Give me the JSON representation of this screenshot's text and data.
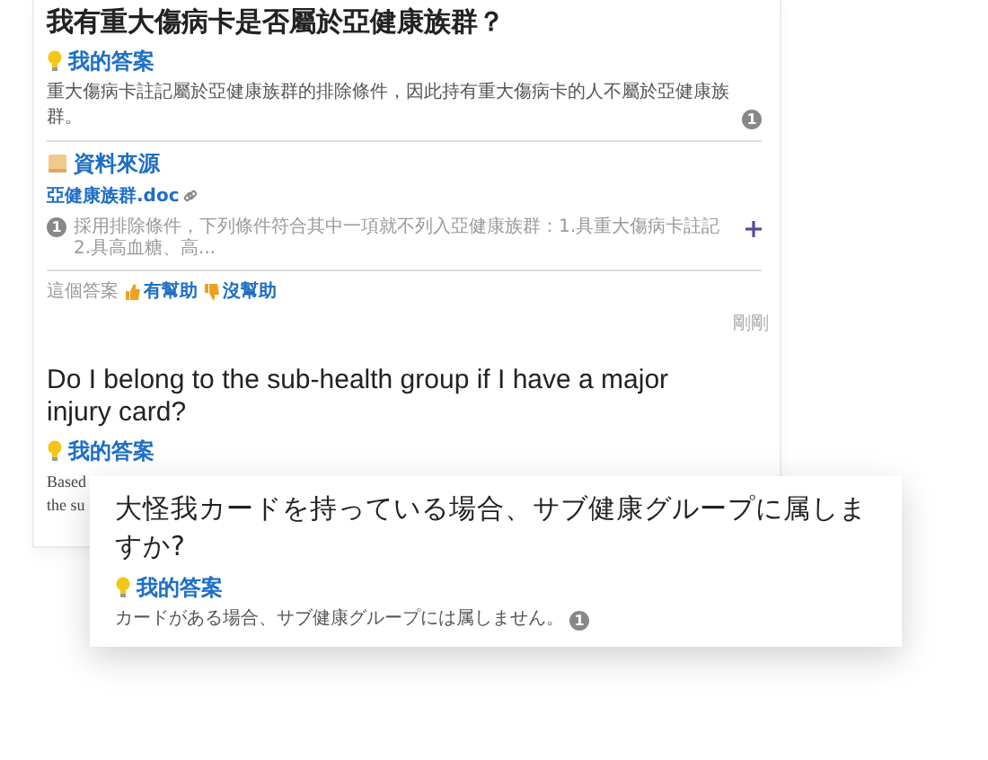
{
  "cards": [
    {
      "question": "我有重大傷病卡是否屬於亞健康族群？",
      "answer": {
        "heading": "我的答案",
        "text": "重大傷病卡註記屬於亞健康族群的排除條件，因此持有重大傷病卡的人不屬於亞健康族群。",
        "ref": "1"
      },
      "sources": {
        "heading": "資料來源",
        "items": [
          {
            "file": "亞健康族群.doc",
            "ref": "1",
            "excerpt": "採用排除條件，下列條件符合其中一項就不列入亞健康族群：1.具重大傷病卡註記 2.具高血糖、高..."
          }
        ]
      },
      "feedback": {
        "label": "這個答案",
        "helpful": "有幫助",
        "unhelpful": "沒幫助"
      },
      "time": "剛剛"
    },
    {
      "question": "Do I belong to the sub-health group if I have a major injury card?",
      "answer": {
        "heading": "我的答案",
        "lines": [
          "Based",
          "the su"
        ]
      }
    }
  ],
  "overlay": {
    "question": "大怪我カードを持っている場合、サブ健康グループに属しますか?",
    "answer": {
      "heading": "我的答案",
      "text": "カードがある場合、サブ健康グループには属しません。",
      "ref": "1"
    }
  }
}
